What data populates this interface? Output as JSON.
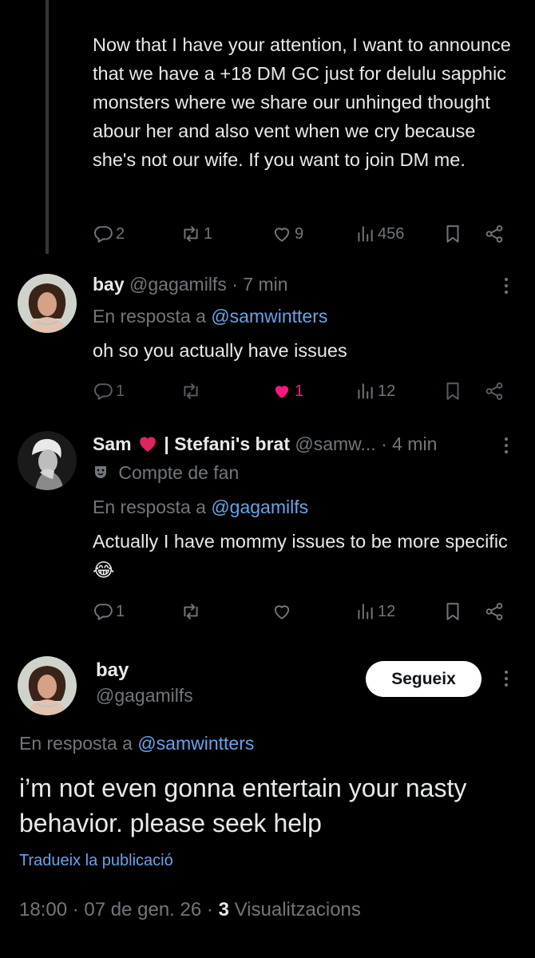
{
  "tweet1": {
    "text": "Now that I have your attention, I want to announce that we have  a +18 DM GC just for delulu sapphic monsters where we share our unhinged thought abour her and also vent when we cry because she's not our wife. If you want to join DM me.",
    "replies": "2",
    "reposts": "1",
    "likes": "9",
    "views": "456"
  },
  "reply1": {
    "display_name": "bay",
    "handle": "@gagamilfs",
    "time": "· 7 min",
    "reply_prefix": "En resposta a",
    "reply_to": "@samwintters",
    "text": "oh so you actually have issues",
    "replies": "1",
    "likes": "1",
    "views": "12"
  },
  "reply2": {
    "display_name": "Sam",
    "name_suffix": "| Stefani's brat",
    "handle": "@samw...",
    "time": "· 4 min",
    "badge_label": "Compte de fan",
    "reply_prefix": "En resposta a",
    "reply_to": "@gagamilfs",
    "text": "Actually I have mommy issues to be more specific",
    "emoji": "😂",
    "replies": "1",
    "views": "12"
  },
  "main_tweet": {
    "display_name": "bay",
    "handle": "@gagamilfs",
    "follow_label": "Segueix",
    "reply_prefix": "En resposta a",
    "reply_to": "@samwintters",
    "text": "i’m not even gonna entertain your nasty behavior. please seek help",
    "translate_label": "Tradueix la publicació",
    "time": "18:00",
    "date": "07 de gen. 26",
    "views_count": "3",
    "views_label": "Visualitzacions"
  },
  "colors": {
    "background": "#000000",
    "text": "#e7e9ea",
    "muted": "#71767b",
    "link": "#6aa3e6",
    "like": "#f91880"
  }
}
